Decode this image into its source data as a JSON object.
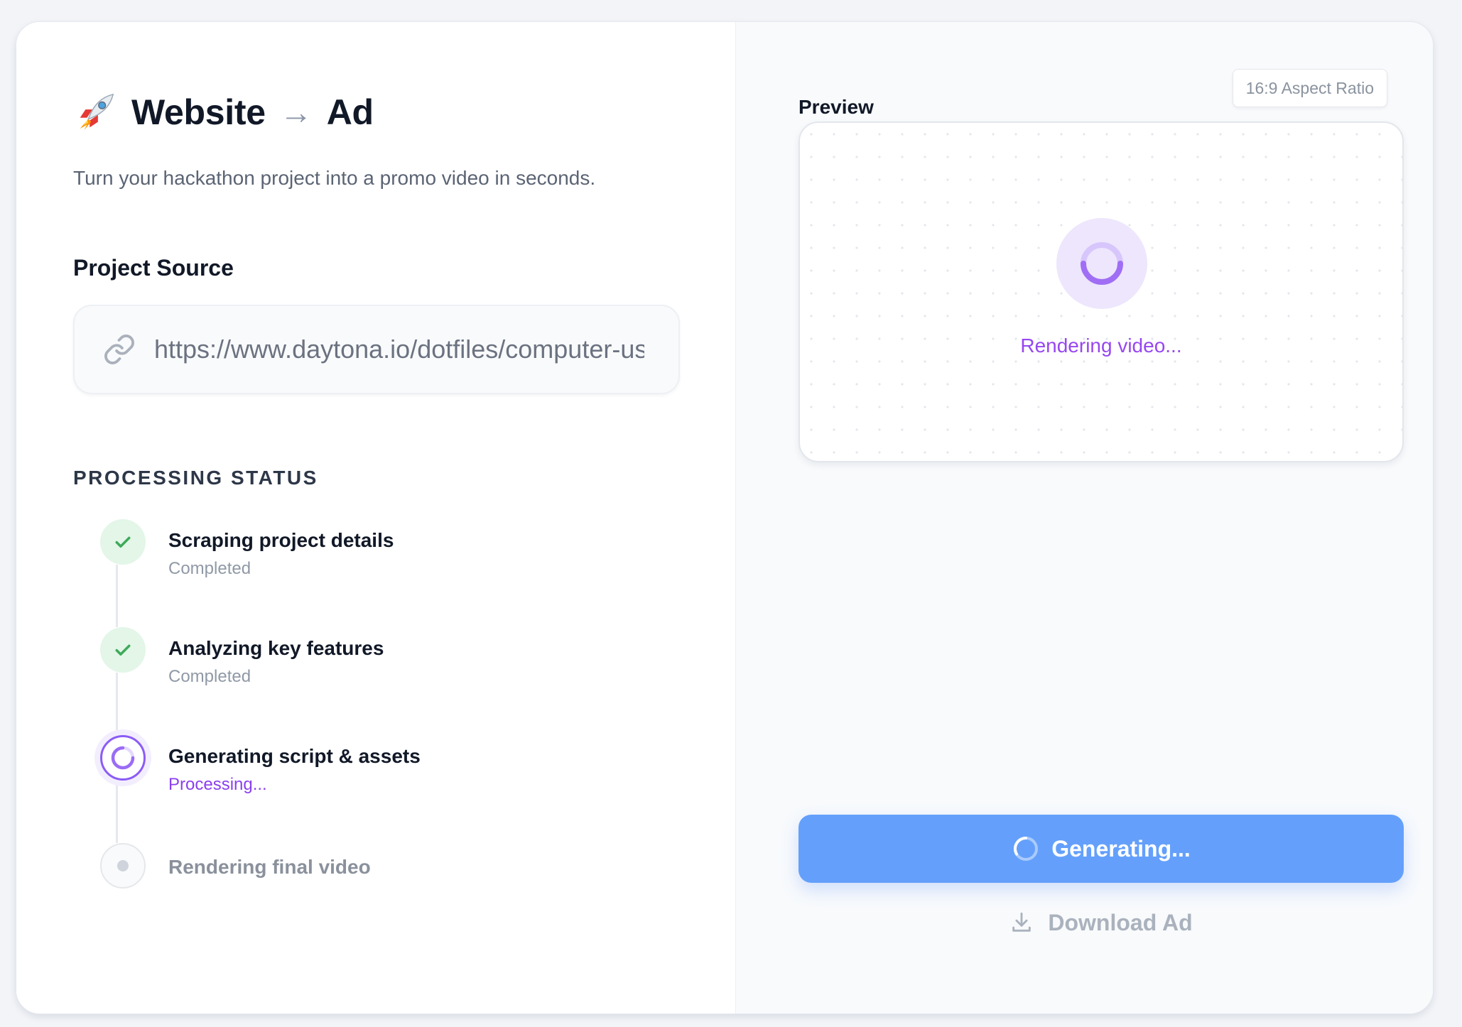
{
  "header": {
    "icon": "rocket-icon",
    "title_left": "Website",
    "arrow": "→",
    "title_right": "Ad",
    "subtitle": "Turn your hackathon project into a promo video in seconds."
  },
  "project_source": {
    "label": "Project Source",
    "icon": "link-icon",
    "url_value": "https://www.daytona.io/dotfiles/computer-us"
  },
  "processing": {
    "heading": "PROCESSING STATUS",
    "steps": [
      {
        "title": "Scraping project details",
        "status": "Completed",
        "state": "done",
        "icon": "check-icon"
      },
      {
        "title": "Analyzing key features",
        "status": "Completed",
        "state": "done",
        "icon": "check-icon"
      },
      {
        "title": "Generating script & assets",
        "status": "Processing...",
        "state": "active",
        "icon": "spinner-icon"
      },
      {
        "title": "Rendering final video",
        "status": "",
        "state": "pending",
        "icon": "pending-dot-icon"
      }
    ]
  },
  "preview": {
    "label": "Preview",
    "aspect_badge": "16:9 Aspect Ratio",
    "status_text": "Rendering video..."
  },
  "actions": {
    "generate_label": "Generating...",
    "download_label": "Download Ad"
  },
  "colors": {
    "accent_purple": "#8b5cf6",
    "success_green": "#3faa5a",
    "button_blue": "#64a0fb",
    "text_dark": "#111827"
  }
}
